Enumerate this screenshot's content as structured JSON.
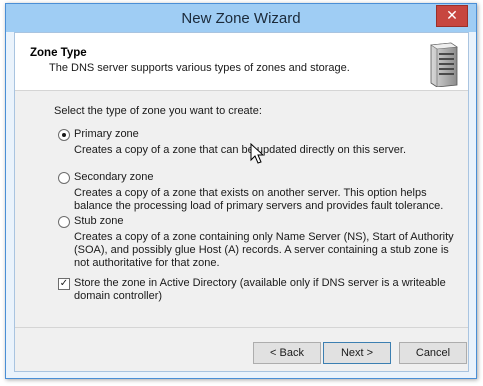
{
  "window": {
    "title": "New Zone Wizard",
    "close_glyph": "✕"
  },
  "header": {
    "title": "Zone Type",
    "subtitle": "The DNS server supports various types of zones and storage.",
    "icon": "server-icon"
  },
  "prompt": "Select the type of zone you want to create:",
  "options": [
    {
      "label": "Primary zone",
      "selected": true,
      "description": "Creates a copy of a zone that can be updated directly on this server."
    },
    {
      "label": "Secondary zone",
      "selected": false,
      "description": "Creates a copy of a zone that exists on another server. This option helps balance the processing load of primary servers and provides fault tolerance."
    },
    {
      "label": "Stub zone",
      "selected": false,
      "description": "Creates a copy of a zone containing only Name Server (NS), Start of Authority (SOA), and possibly glue Host (A) records. A server containing a stub zone is not authoritative for that zone."
    }
  ],
  "ad_checkbox": {
    "label": "Store the zone in Active Directory (available only if DNS server is a writeable domain controller)",
    "checked": true,
    "check_glyph": "✓"
  },
  "buttons": {
    "back": "< Back",
    "next": "Next >",
    "cancel": "Cancel"
  }
}
